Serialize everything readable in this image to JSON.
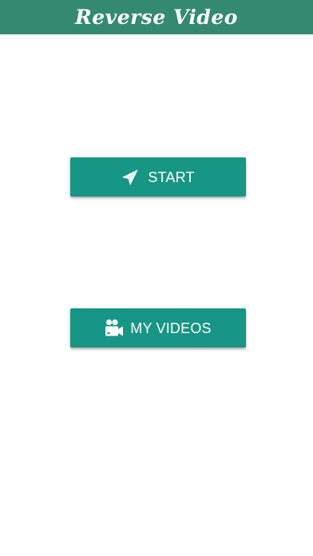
{
  "header": {
    "title": "Reverse Video"
  },
  "buttons": {
    "start": {
      "label": "START",
      "icon": "paper-plane-icon"
    },
    "my_videos": {
      "label": "MY VIDEOS",
      "icon": "video-camera-icon"
    }
  },
  "colors": {
    "header_bg": "#348a6f",
    "button_bg": "#179585",
    "text": "#ffffff",
    "page_bg": "#ffffff"
  }
}
